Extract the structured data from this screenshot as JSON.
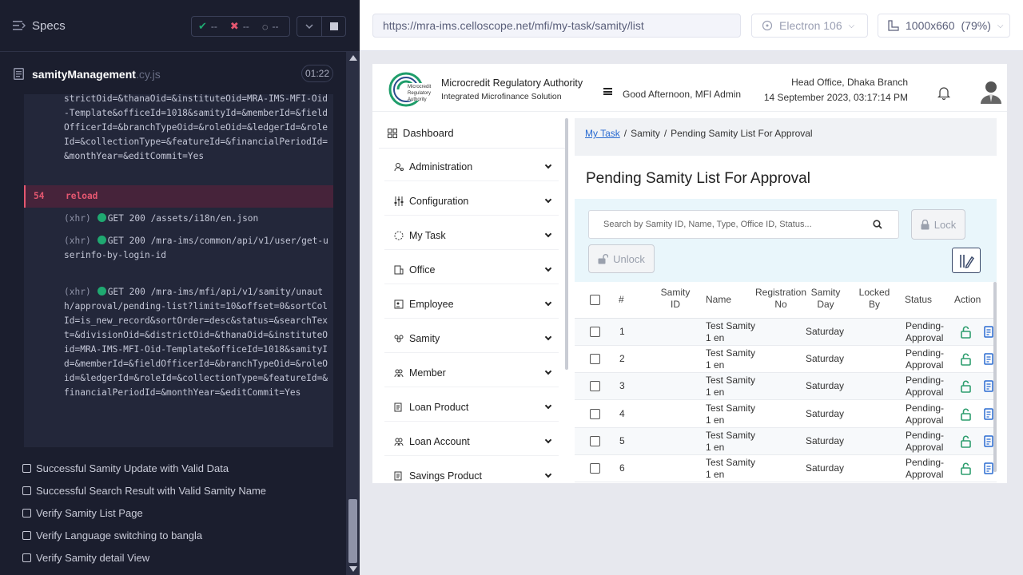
{
  "runner": {
    "title": "Specs",
    "stats": {
      "passed": "--",
      "failed": "--",
      "pending": "--"
    },
    "spec": {
      "name": "samityManagement",
      "ext": ".cy.js",
      "time": "01:22"
    },
    "log_top": "strictOid=&thanaOid=&instituteOid=MRA-IMS-MFI-Oid-Template&officeId=1018&samityId=&memberId=&fieldOfficerId=&branchTypeOid=&roleOid=&ledgerId=&roleId=&collectionType=&featureId=&financialPeriodId=&monthYear=&editCommit=Yes",
    "reload": {
      "num": "54",
      "label": "reload"
    },
    "xhr": [
      {
        "tag": "(xhr)",
        "text": "GET 200 /assets/i18n/en.json"
      },
      {
        "tag": "(xhr)",
        "text": "GET 200 /mra-ims/common/api/v1/user/get-userinfo-by-login-id"
      },
      {
        "tag": "(xhr)",
        "text": "GET 200 /mra-ims/mfi/api/v1/samity/unauth/approval/pending-list?limit=10&offset=0&sortColId=is_new_record&sortOrder=desc&status=&searchText=&divisionOid=&districtOid=&thanaOid=&instituteOid=MRA-IMS-MFI-Oid-Template&officeId=1018&samityId=&memberId=&fieldOfficerId=&branchTypeOid=&roleOid=&ledgerId=&roleId=&collectionType=&featureId=&financialPeriodId=&monthYear=&editCommit=Yes"
      }
    ],
    "tests": [
      "Successful Samity Update with Valid Data",
      "Successful Search Result with Valid Samity Name",
      "Verify Samity List Page",
      "Verify Language switching to bangla",
      "Verify Samity detail View"
    ]
  },
  "aut": {
    "url": "https://mra-ims.celloscope.net/mfi/my-task/samity/list",
    "browser": "Electron 106",
    "viewport": "1000x660",
    "zoom": "(79%)"
  },
  "app": {
    "org_name": "Microcredit Regulatory Authority",
    "org_sub": "Integrated Microfinance Solution",
    "greeting": "Good Afternoon, MFI Admin",
    "branch": "Head Office, Dhaka Branch",
    "datetime": "14 September 2023, 03:17:14 PM",
    "sidebar": {
      "dashboard": "Dashboard",
      "items": [
        "Administration",
        "Configuration",
        "My Task",
        "Office",
        "Employee",
        "Samity",
        "Member",
        "Loan Product",
        "Loan Account",
        "Savings Product"
      ]
    },
    "breadcrumb": {
      "link": "My Task",
      "mid": "Samity",
      "current": "Pending Samity List For Approval"
    },
    "page_title": "Pending Samity List For Approval",
    "search_placeholder": "Search by Samity ID, Name, Type, Office ID, Status...",
    "lock_label": "Lock",
    "unlock_label": "Unlock",
    "columns": {
      "num": "#",
      "samity_id": "Samity ID",
      "name": "Name",
      "reg_no": "Registration No",
      "samity_day": "Samity Day",
      "locked_by": "Locked By",
      "status": "Status",
      "action": "Action"
    },
    "rows": [
      {
        "num": "1",
        "name": "Test Samity 1 en",
        "day": "Saturday",
        "status": "Pending-Approval"
      },
      {
        "num": "2",
        "name": "Test Samity 1 en",
        "day": "Saturday",
        "status": "Pending-Approval"
      },
      {
        "num": "3",
        "name": "Test Samity 1 en",
        "day": "Saturday",
        "status": "Pending-Approval"
      },
      {
        "num": "4",
        "name": "Test Samity 1 en",
        "day": "Saturday",
        "status": "Pending-Approval"
      },
      {
        "num": "5",
        "name": "Test Samity 1 en",
        "day": "Saturday",
        "status": "Pending-Approval"
      },
      {
        "num": "6",
        "name": "Test Samity 1 en",
        "day": "Saturday",
        "status": "Pending-Approval"
      }
    ]
  },
  "colors": {
    "pass": "#1fa971",
    "fail": "#e45770",
    "link": "#2a6bd1",
    "action": "#2f9e6f"
  }
}
